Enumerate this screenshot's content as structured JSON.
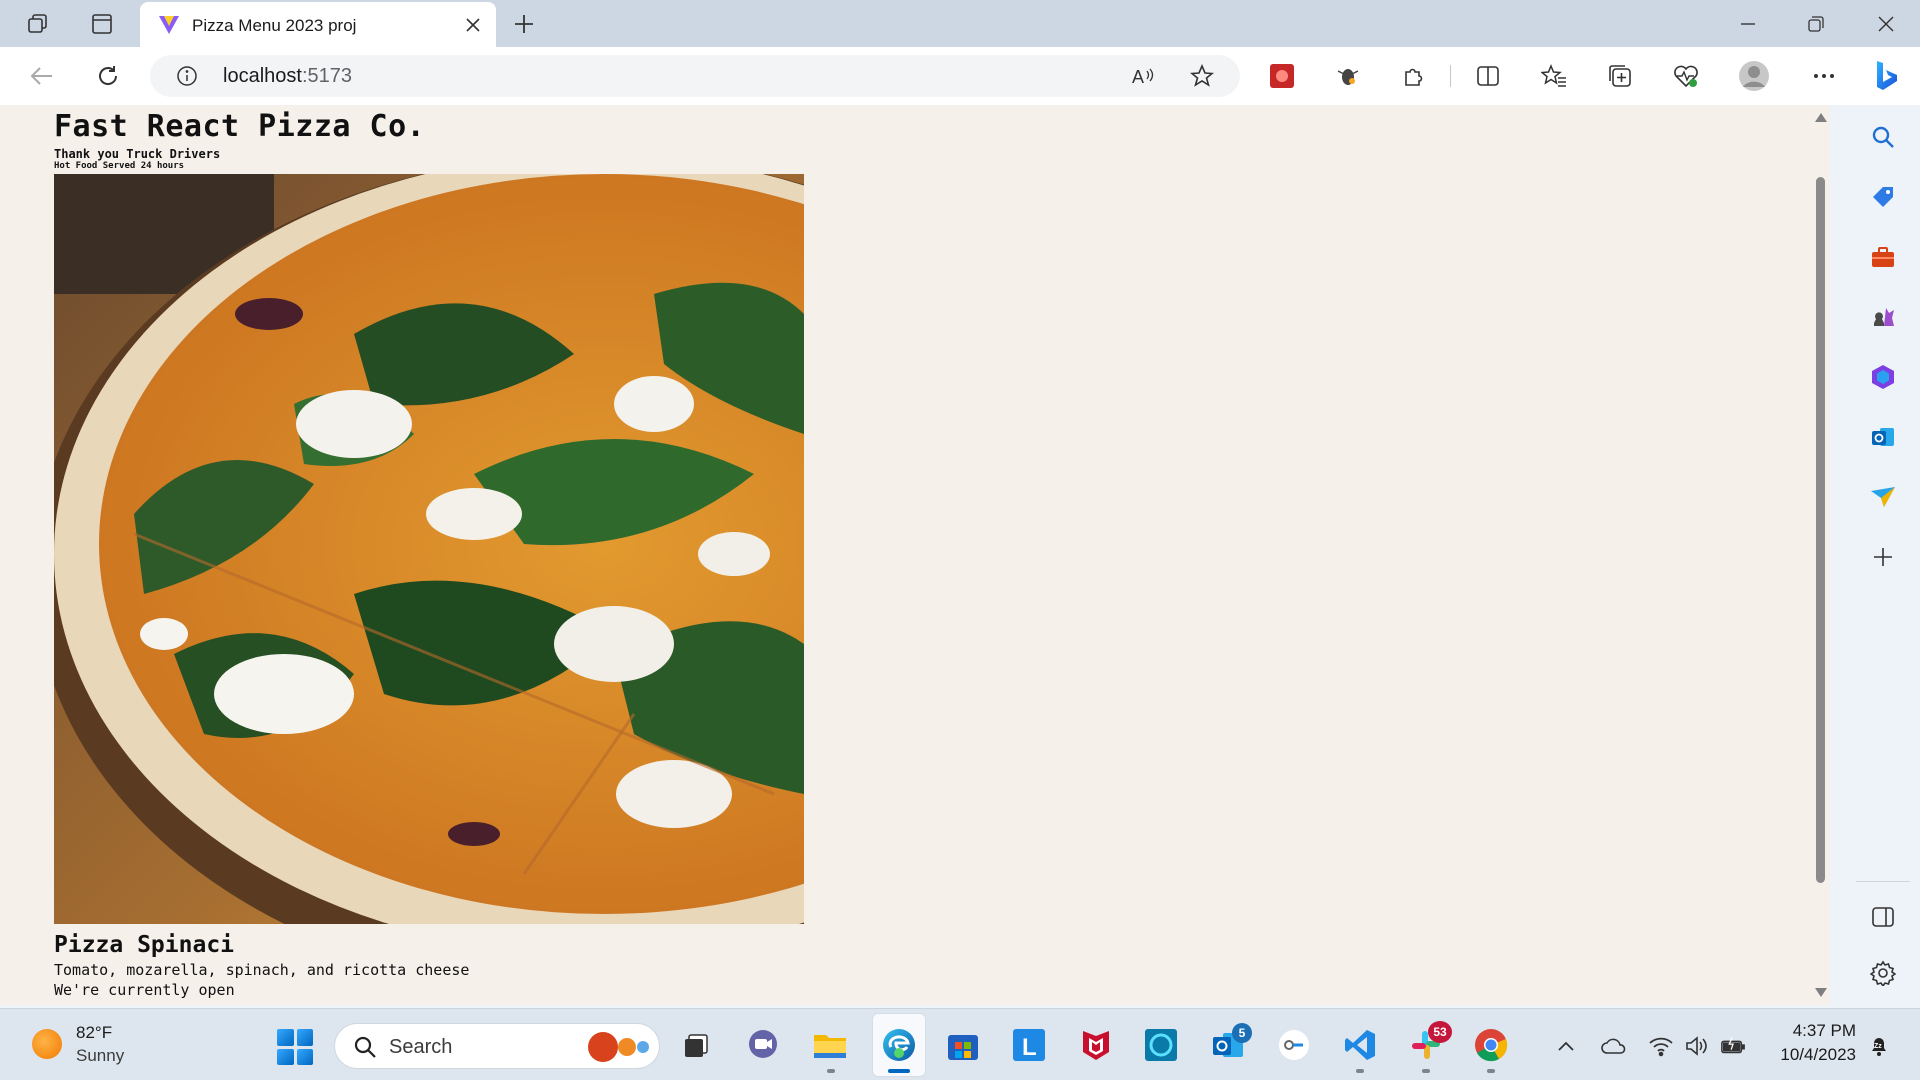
{
  "browser": {
    "tab_title": "Pizza Menu 2023 proj",
    "url_host": "localhost",
    "url_port": ":5173",
    "accent": "#0067c0"
  },
  "page": {
    "title": "Fast React Pizza Co.",
    "subtitle": "Thank you Truck Drivers",
    "tagline": "Hot Food Served 24 hours",
    "pizza": {
      "name": "Pizza Spinaci",
      "ingredients": "Tomato, mozarella, spinach, and ricotta cheese",
      "photo_alt": "pizza-spinaci-photo"
    },
    "status": "We're currently open",
    "background": "#f5f0ea"
  },
  "taskbar": {
    "weather_temp": "82°F",
    "weather_condition": "Sunny",
    "search_placeholder": "Search",
    "outlook_badge": "5",
    "slack_badge": "53",
    "time": "4:37 PM",
    "date": "10/4/2023"
  }
}
